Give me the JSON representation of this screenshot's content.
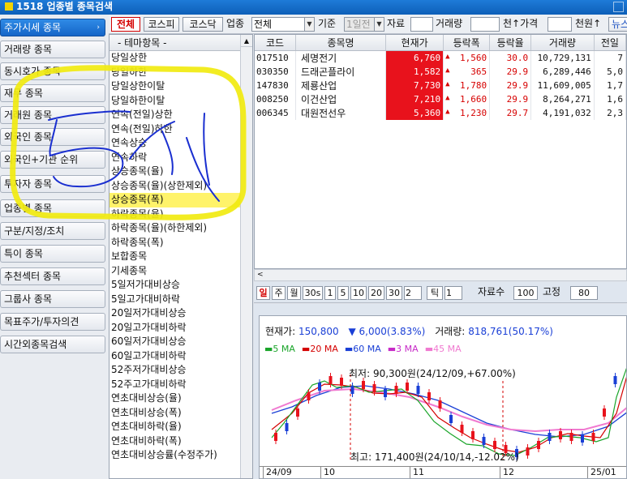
{
  "window": {
    "title": "1518 업종별 종목검색"
  },
  "nav": {
    "items": [
      {
        "label": "주가시세 종목",
        "active": true
      },
      {
        "label": "거래량 종목"
      },
      {
        "label": "동시호가 종목"
      },
      {
        "label": "재무 종목"
      },
      {
        "label": "거래원 종목"
      },
      {
        "label": "외국인 종목"
      },
      {
        "label": "외국인+기관 순위"
      },
      {
        "label": "투자자 종목"
      },
      {
        "label": "업종별 종목"
      },
      {
        "label": "구분/지정/조치"
      },
      {
        "label": "특이 종목"
      },
      {
        "label": "추천섹터 종목"
      },
      {
        "label": "그룹사 종목"
      },
      {
        "label": "목표주가/투자의견"
      },
      {
        "label": "시간외종목검색"
      }
    ],
    "active_arrow": "›"
  },
  "toolbar": {
    "market_tabs": [
      "전체",
      "코스피",
      "코스닥"
    ],
    "sector_label": "업종",
    "sector_value": "전체",
    "basis_label": "기준",
    "basis_value": "1일전",
    "data_label": "자료",
    "volume_label": "거래량",
    "volume_unit": "천↑가격",
    "price_unit": "천원↑",
    "news_label": "뉴스"
  },
  "theme_list": {
    "header": "- 테마항목 -",
    "items": [
      "당일상한",
      "당일하한",
      "당일상한이탈",
      "당일하한이탈",
      "연속(전일)상한",
      "연속(전일)하한",
      "연속상승",
      "연속하락",
      "상승종목(율)",
      "상승종목(율)(상한제외)",
      "상승종목(폭)",
      "하락종목(율)",
      "하락종목(율)(하한제외)",
      "하락종목(폭)",
      "보합종목",
      "기세종목",
      "5일저가대비상승",
      "5일고가대비하락",
      "20일저가대비상승",
      "20일고가대비하락",
      "60일저가대비상승",
      "60일고가대비하락",
      "52주저가대비상승",
      "52주고가대비하락",
      "연초대비상승(율)",
      "연초대비상승(폭)",
      "연초대비하락(율)",
      "연초대비하락(폭)",
      "연초대비상승률(수정주가)"
    ],
    "selected_index": 10
  },
  "table": {
    "columns": [
      "코드",
      "종목명",
      "현재가",
      "등락폭",
      "등락율",
      "거래량",
      "전일"
    ],
    "rows": [
      {
        "code": "017510",
        "name": "세명전기",
        "price": "6,760",
        "change": "1,560",
        "rate": "30.0",
        "volume": "10,729,131",
        "prev": "7"
      },
      {
        "code": "030350",
        "name": "드래곤플라이",
        "price": "1,582",
        "change": "365",
        "rate": "29.9",
        "volume": "6,289,446",
        "prev": "5,0"
      },
      {
        "code": "147830",
        "name": "제룡산업",
        "price": "7,730",
        "change": "1,780",
        "rate": "29.9",
        "volume": "11,609,005",
        "prev": "1,7"
      },
      {
        "code": "008250",
        "name": "이건산업",
        "price": "7,210",
        "change": "1,660",
        "rate": "29.9",
        "volume": "8,264,271",
        "prev": "1,6"
      },
      {
        "code": "006345",
        "name": "대원전선우",
        "price": "5,360",
        "change": "1,230",
        "rate": "29.7",
        "volume": "4,191,032",
        "prev": "2,3"
      }
    ],
    "up_arrow": "▲",
    "scroll_left": "<"
  },
  "chart_controls": {
    "periods": [
      "일",
      "주",
      "월",
      "30s",
      "1",
      "5",
      "10",
      "20",
      "30"
    ],
    "minute_value": "2",
    "tick_label": "틱",
    "tick_value": "1",
    "count_label": "자료수",
    "count_value": "100",
    "fixed_label": "고정",
    "fixed_value": "80"
  },
  "chart": {
    "price_label": "현재가:",
    "price_value": "150,800",
    "change_arrow": "▼",
    "change_value": "6,000(3.83%)",
    "volume_label": "거래량:",
    "volume_value": "818,761(50.17%)",
    "ma_legend": [
      {
        "label": "5 MA",
        "color": "#1aa52a"
      },
      {
        "label": "20 MA",
        "color": "#d40000"
      },
      {
        "label": "60 MA",
        "color": "#1a3fd6"
      },
      {
        "label": "3 MA",
        "color": "#c72ac7"
      },
      {
        "label": "45 MA",
        "color": "#f07ad0"
      }
    ],
    "low_annotation": "최저: 90,300원(24/12/09,+67.00%)",
    "high_annotation": "최고: 171,400원(24/10/14,-12.02%)",
    "date_ticks": [
      "24/09",
      "10",
      "11",
      "12",
      "25/01"
    ]
  },
  "colors": {
    "accent": "#1565c8",
    "up": "#e8121c",
    "highlight": "#f1ea10",
    "ink": "#1a2fd0"
  }
}
